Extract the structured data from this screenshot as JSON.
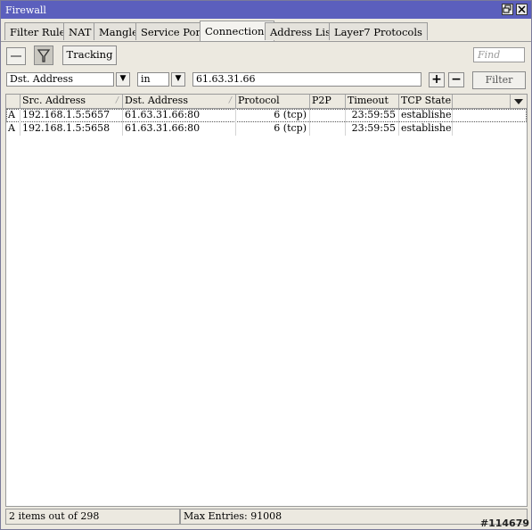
{
  "window": {
    "title": "Firewall"
  },
  "tabs": [
    {
      "label": "Filter Rules"
    },
    {
      "label": "NAT"
    },
    {
      "label": "Mangle"
    },
    {
      "label": "Service Ports"
    },
    {
      "label": "Connections"
    },
    {
      "label": "Address Lists"
    },
    {
      "label": "Layer7 Protocols"
    }
  ],
  "active_tab": "Connections",
  "toolbar": {
    "tracking_label": "Tracking",
    "find_placeholder": "Find"
  },
  "filter": {
    "field": "Dst. Address",
    "operator": "in",
    "value": "61.63.31.66",
    "add_symbol": "+",
    "remove_symbol": "−",
    "button_label": "Filter"
  },
  "table": {
    "columns": [
      "Src. Address",
      "Dst. Address",
      "Protocol",
      "P2P",
      "Timeout",
      "TCP State"
    ],
    "rows": [
      {
        "flag": "A",
        "src": "192.168.1.5:5657",
        "dst": "61.63.31.66:80",
        "protocol": "6 (tcp)",
        "p2p": "",
        "timeout": "23:59:55",
        "state": "established"
      },
      {
        "flag": "A",
        "src": "192.168.1.5:5658",
        "dst": "61.63.31.66:80",
        "protocol": "6 (tcp)",
        "p2p": "",
        "timeout": "23:59:55",
        "state": "established"
      }
    ]
  },
  "status": {
    "items": "2 items out of 298",
    "max_entries": "Max Entries: 91008"
  },
  "watermark": "#114679"
}
